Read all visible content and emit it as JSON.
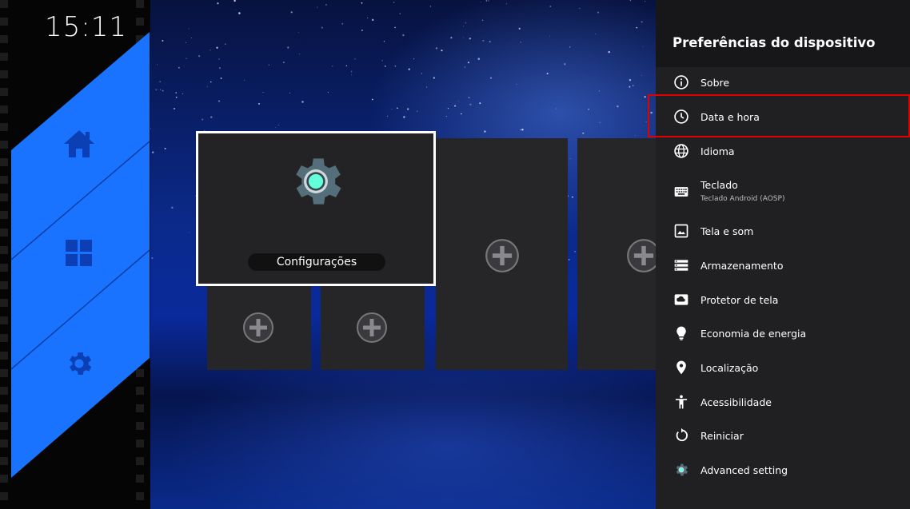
{
  "clock": "15:11",
  "left_rail": {
    "items": [
      {
        "name": "home-icon"
      },
      {
        "name": "apps-grid-icon"
      },
      {
        "name": "gear-icon"
      }
    ],
    "accent": "#1a73ff"
  },
  "focused_app": {
    "label": "Configurações",
    "icon": "settings-gear-icon"
  },
  "panel": {
    "title": "Preferências do dispositivo",
    "items": [
      {
        "label": "Sobre",
        "icon": "info-icon"
      },
      {
        "label": "Data e hora",
        "icon": "clock-icon"
      },
      {
        "label": "Idioma",
        "icon": "globe-icon"
      },
      {
        "label": "Teclado",
        "sub": "Teclado Android (AOSP)",
        "icon": "keyboard-icon"
      },
      {
        "label": "Tela e som",
        "icon": "image-icon"
      },
      {
        "label": "Armazenamento",
        "icon": "storage-icon"
      },
      {
        "label": "Protetor de tela",
        "icon": "screensaver-icon"
      },
      {
        "label": "Economia de energia",
        "icon": "lightbulb-icon"
      },
      {
        "label": "Localização",
        "icon": "location-pin-icon"
      },
      {
        "label": "Acessibilidade",
        "icon": "accessibility-icon"
      },
      {
        "label": "Reiniciar",
        "icon": "restart-icon"
      },
      {
        "label": "Advanced setting",
        "icon": "advanced-gear-icon"
      }
    ]
  },
  "colors": {
    "highlight_border": "#e00000",
    "panel_bg": "#202022"
  }
}
